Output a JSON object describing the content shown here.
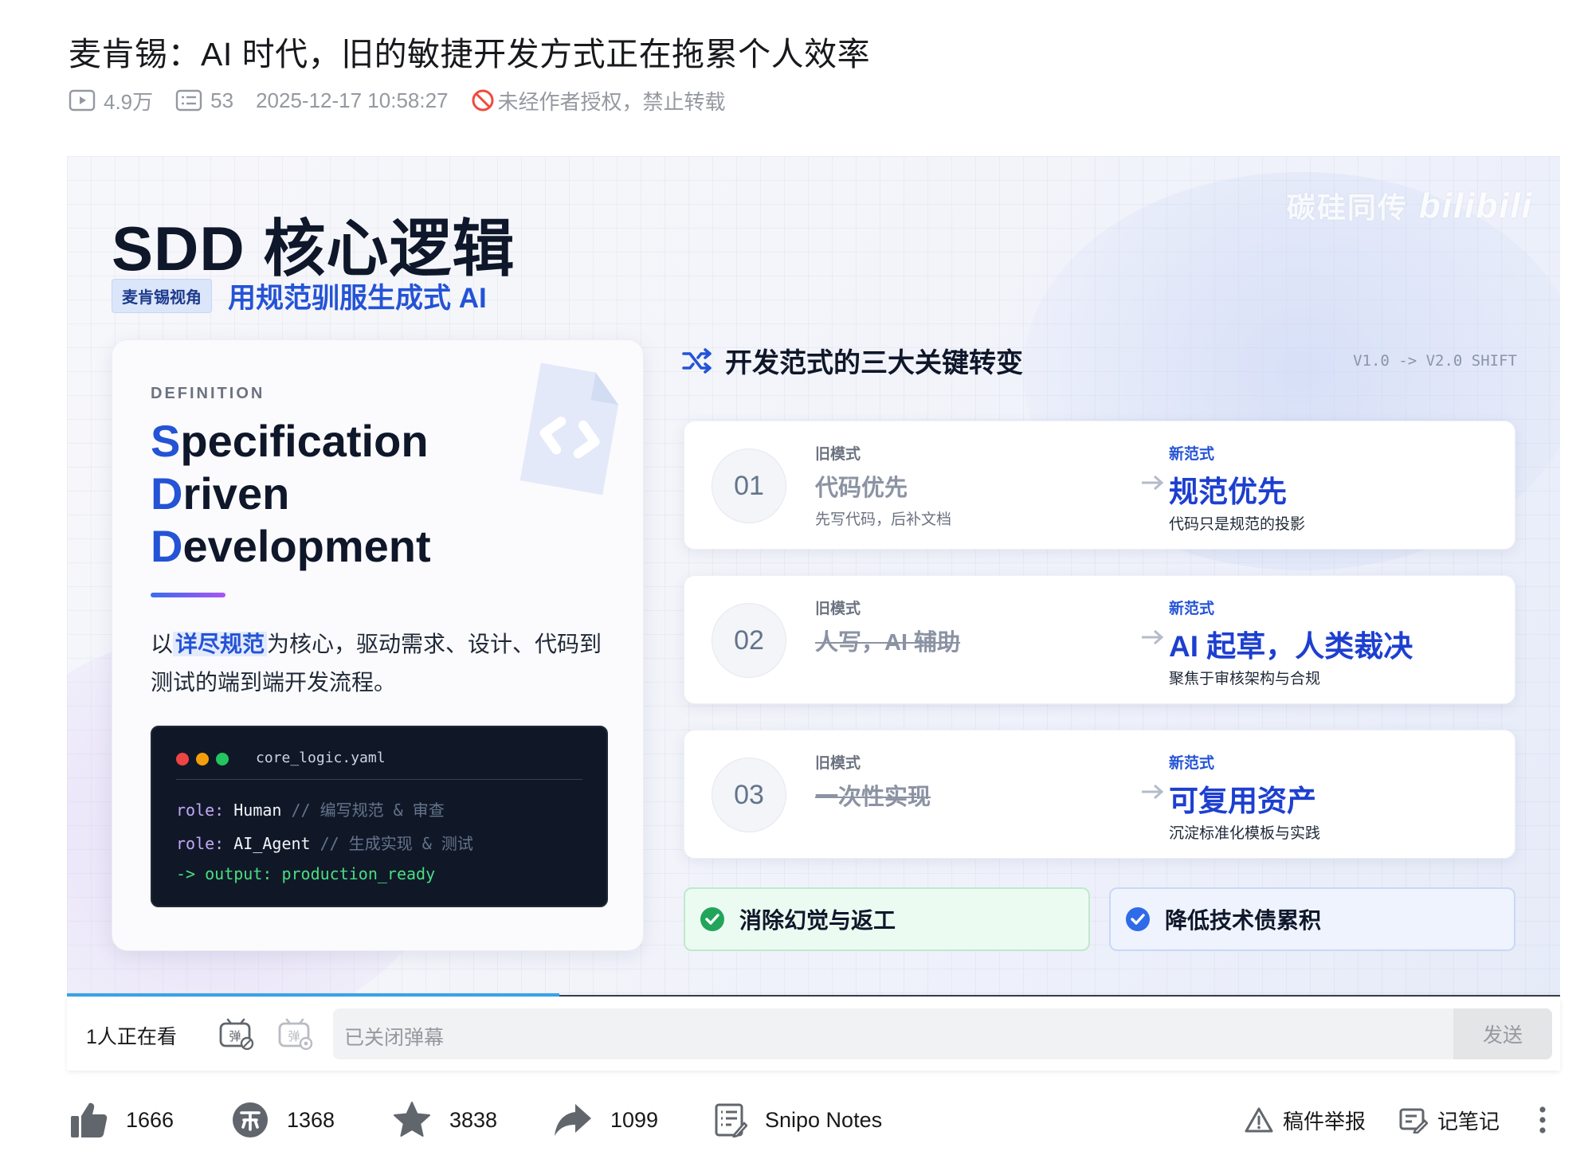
{
  "page": {
    "title": "麦肯锡：AI 时代，旧的敏捷开发方式正在拖累个人效率",
    "meta": {
      "views": "4.9万",
      "danmaku_count": "53",
      "datetime": "2025-12-17 10:58:27",
      "copyright": "未经作者授权，禁止转载"
    }
  },
  "slide": {
    "title": "SDD 核心逻辑",
    "watermark_text": "碳硅同传",
    "watermark_logo": "bilibili",
    "tag": "麦肯锡视角",
    "subtitle": "用规范驯服生成式 AI",
    "definition_label": "DEFINITION",
    "term": [
      {
        "cap": "S",
        "rest": "pecification"
      },
      {
        "cap": "D",
        "rest": "riven"
      },
      {
        "cap": "D",
        "rest": "evelopment"
      }
    ],
    "description": {
      "prefix": "以",
      "highlight": "详尽规范",
      "suffix": "为核心，驱动需求、设计、代码到测试的端到端开发流程。"
    },
    "code": {
      "filename": "core_logic.yaml",
      "lines": [
        {
          "key": "role:",
          "value": " Human",
          "comment": " // 编写规范 & 审查"
        },
        {
          "key": "role:",
          "value": " AI_Agent",
          "comment": " // 生成实现 & 测试"
        },
        {
          "key": "-> output:",
          "value": " production_ready",
          "comment": ""
        }
      ],
      "dot_colors": [
        "#ef4444",
        "#f59e0b",
        "#22c55e"
      ]
    },
    "shift_heading": "开发范式的三大关键转变",
    "version": "V1.0 -> V2.0 SHIFT",
    "shifts": [
      {
        "num": "01",
        "old_label": "旧模式",
        "old_title": "代码优先",
        "old_sub": "先写代码，后补文档",
        "new_label": "新范式",
        "new_title": "规范优先",
        "new_sub": "代码只是规范的投影"
      },
      {
        "num": "02",
        "old_label": "旧模式",
        "old_title": "人写，AI 辅助",
        "old_sub": "",
        "new_label": "新范式",
        "new_title": "AI 起草，人类裁决",
        "new_sub": "聚焦于审核架构与合规"
      },
      {
        "num": "03",
        "old_label": "旧模式",
        "old_title": "一次性实现",
        "old_sub": "",
        "new_label": "新范式",
        "new_title": "可复用资产",
        "new_sub": "沉淀标准化模板与实践"
      }
    ],
    "badges": {
      "left": "消除幻觉与返工",
      "right": "降低技术债累积"
    },
    "accent_color": "#2453d6"
  },
  "player": {
    "progress": 0.33,
    "watching": "1人正在看",
    "danmaku_placeholder": "已关闭弹幕",
    "send_label": "发送"
  },
  "actions": {
    "like": "1666",
    "coin": "1368",
    "favorite": "3838",
    "share": "1099",
    "notes_app": "Snipo Notes",
    "report": "稿件举报",
    "take_notes": "记笔记"
  }
}
